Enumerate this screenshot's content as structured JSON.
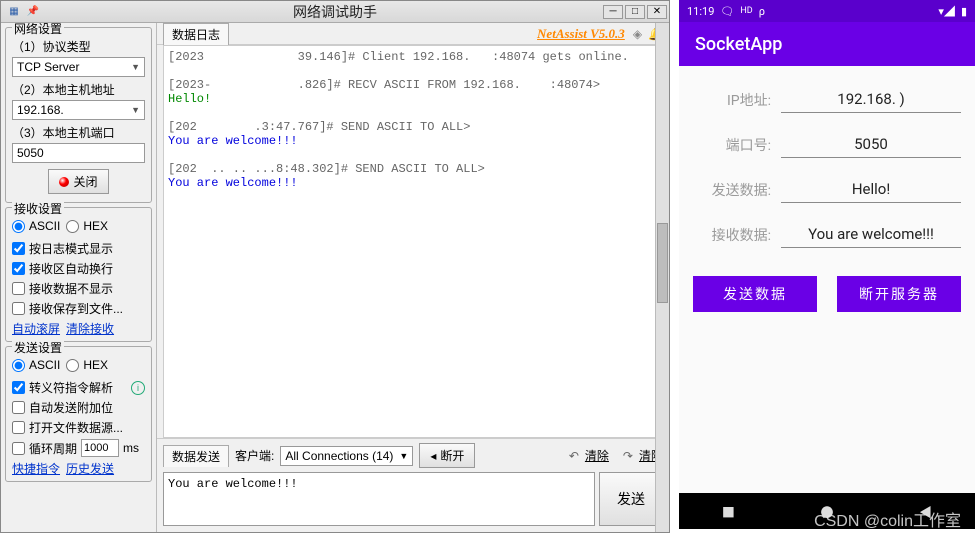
{
  "win": {
    "title": "网络调试助手",
    "brand": "NetAssist V5.0.3",
    "network_group": "网络设置",
    "proto_label": "（1）协议类型",
    "proto_value": "TCP Server",
    "host_label": "（2）本地主机地址",
    "host_value": "192.168.",
    "port_label": "（3）本地主机端口",
    "port_value": "5050",
    "close_btn": "关闭",
    "recv_group": "接收设置",
    "radio_ascii": "ASCII",
    "radio_hex": "HEX",
    "recv_opts": [
      {
        "label": "按日志模式显示",
        "checked": true
      },
      {
        "label": "接收区自动换行",
        "checked": true
      },
      {
        "label": "接收数据不显示",
        "checked": false
      },
      {
        "label": "接收保存到文件...",
        "checked": false
      }
    ],
    "recv_links": {
      "a": "自动滚屏",
      "b": "清除接收"
    },
    "send_group": "发送设置",
    "send_opts": [
      {
        "label": "转义符指令解析",
        "checked": true,
        "info": true
      },
      {
        "label": "自动发送附加位",
        "checked": false
      },
      {
        "label": "打开文件数据源...",
        "checked": false
      }
    ],
    "cycle_label": "循环周期",
    "cycle_value": "1000",
    "cycle_unit": "ms",
    "send_links": {
      "a": "快捷指令",
      "b": "历史发送"
    },
    "log_tab": "数据日志",
    "log_lines": [
      {
        "cls": "c-gray",
        "text": "[2023             39.146]# Client 192.168.   :48074 gets online."
      },
      {
        "cls": "",
        "text": " "
      },
      {
        "cls": "c-gray",
        "text": "[2023-            .826]# RECV ASCII FROM 192.168.    :48074>"
      },
      {
        "cls": "c-green",
        "text": "Hello!"
      },
      {
        "cls": "",
        "text": " "
      },
      {
        "cls": "c-gray",
        "text": "[202        .3:47.767]# SEND ASCII TO ALL>"
      },
      {
        "cls": "c-blue",
        "text": "You are welcome!!!"
      },
      {
        "cls": "",
        "text": " "
      },
      {
        "cls": "c-gray",
        "text": "[202  .. .. ...8:48.302]# SEND ASCII TO ALL>"
      },
      {
        "cls": "c-blue",
        "text": "You are welcome!!!"
      }
    ],
    "sendbar": {
      "tab_send": "数据发送",
      "tab_client": "客户端:",
      "combo": "All Connections (14)",
      "disconnect": "断开",
      "clear": "清除",
      "clear2": "清除"
    },
    "send_input": "You are welcome!!!",
    "send_btn": "发送"
  },
  "phone": {
    "time": "11:19",
    "app_title": "SocketApp",
    "ip_label": "IP地址:",
    "ip_value": "192.168.      )",
    "port_label": "端口号:",
    "port_value": "5050",
    "send_label": "发送数据:",
    "send_value": "Hello!",
    "recv_label": "接收数据:",
    "recv_value": "You are welcome!!!",
    "btn_send": "发送数据",
    "btn_disconnect": "断开服务器"
  },
  "watermark": "CSDN @colin工作室"
}
